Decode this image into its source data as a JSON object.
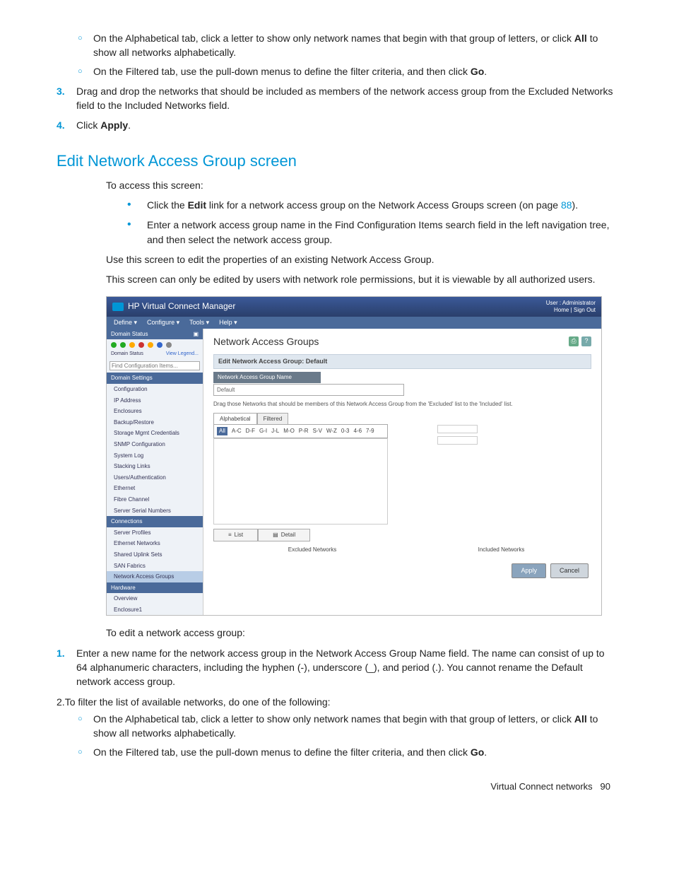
{
  "top": {
    "sub_alpha": "On the Alphabetical tab, click a letter to show only network names that begin with that group of letters, or click ",
    "sub_alpha_bold": "All",
    "sub_alpha_after": " to show all networks alphabetically.",
    "sub_filtered_pre": "On the Filtered tab, use the pull-down menus to define the filter criteria, and then click ",
    "sub_filtered_bold": "Go",
    "sub_filtered_after": ".",
    "step3": "Drag and drop the networks that should be included as members of the network access group from the Excluded Networks field to the Included Networks field.",
    "step4_pre": "Click ",
    "step4_bold": "Apply",
    "step4_after": "."
  },
  "heading": "Edit Network Access Group screen",
  "intro": {
    "lead": "To access this screen:",
    "b1_pre": "Click the ",
    "b1_bold": "Edit",
    "b1_mid": " link for a network access group on the Network Access Groups screen (on page ",
    "b1_page": "88",
    "b1_after": ").",
    "b2": "Enter a network access group name in the Find Configuration Items search field in the left navigation tree, and then select the network access group.",
    "p1": "Use this screen to edit the properties of an existing Network Access Group.",
    "p2": "This screen can only be edited by users with network role permissions, but it is viewable by all authorized users."
  },
  "shot": {
    "title": "HP Virtual Connect Manager",
    "user": "User : Administrator",
    "links": "Home  |  Sign Out",
    "menus": [
      "Define ▾",
      "Configure ▾",
      "Tools ▾",
      "Help ▾"
    ],
    "side_status": "Domain Status",
    "domain_status_label": "Domain Status",
    "view_legend": "View Legend...",
    "find_placeholder": "Find Configuration Items...",
    "sect_domain": "Domain Settings",
    "nav_domain": [
      "Configuration",
      "IP Address",
      "Enclosures",
      "Backup/Restore",
      "Storage Mgmt Credentials",
      "SNMP Configuration",
      "System Log",
      "Stacking Links",
      "Users/Authentication",
      "Ethernet",
      "Fibre Channel",
      "Server Serial Numbers"
    ],
    "sect_conn": "Connections",
    "nav_conn": [
      "Server Profiles",
      "Ethernet Networks",
      "Shared Uplink Sets",
      "SAN Fabrics",
      "Network Access Groups"
    ],
    "sect_hw": "Hardware",
    "nav_hw": [
      "Overview",
      "Enclosure1"
    ],
    "main_title": "Network Access Groups",
    "panel_title": "Edit Network Access Group: Default",
    "field_label": "Network Access Group Name",
    "field_value": "Default",
    "instr": "Drag those Networks that should be members of this Network Access Group from the 'Excluded' list to the 'Included' list.",
    "tab_alpha": "Alphabetical",
    "tab_filt": "Filtered",
    "alpha": [
      "All",
      "A-C",
      "D-F",
      "G-I",
      "J-L",
      "M-O",
      "P-R",
      "S-V",
      "W-Z",
      "0-3",
      "4-6",
      "7-9"
    ],
    "view_list": "List",
    "view_detail": "Detail",
    "excl": "Excluded Networks",
    "incl": "Included Networks",
    "apply": "Apply",
    "cancel": "Cancel"
  },
  "below": {
    "lead": "To edit a network access group:",
    "s1": "Enter a new name for the network access group in the Network Access Group Name field. The name can consist of up to 64 alphanumeric characters, including the hyphen (-), underscore (_), and period (.). You cannot rename the Default network access group.",
    "s2": "To filter the list of available networks, do one of the following:",
    "s2a_pre": "On the Alphabetical tab, click a letter to show only network names that begin with that group of letters, or click ",
    "s2a_bold": "All",
    "s2a_after": " to show all networks alphabetically.",
    "s2b_pre": "On the Filtered tab, use the pull-down menus to define the filter criteria, and then click ",
    "s2b_bold": "Go",
    "s2b_after": "."
  },
  "footer": {
    "section": "Virtual Connect networks",
    "page": "90"
  }
}
